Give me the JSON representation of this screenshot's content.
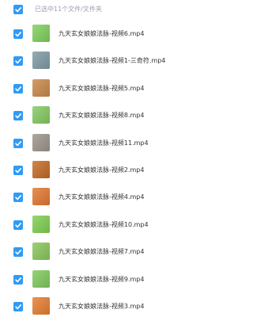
{
  "header": {
    "selection_text": "已选中11个文件/文件夹"
  },
  "files": [
    {
      "name": "九天玄女娘娘法脉-视频6.mp4",
      "thumb_color": "#7fcf5a"
    },
    {
      "name": "九天玄女娘娘法脉-视频1-三奇符.mp4",
      "thumb_color": "#7f9aa5"
    },
    {
      "name": "九天玄女娘娘法脉-视频5.mp4",
      "thumb_color": "#c8884a"
    },
    {
      "name": "九天玄女娘娘法脉-视频8.mp4",
      "thumb_color": "#84c95f"
    },
    {
      "name": "九天玄女娘娘法脉-视频11.mp4",
      "thumb_color": "#9c948a"
    },
    {
      "name": "九天玄女娘娘法脉-视频2.mp4",
      "thumb_color": "#c46a24"
    },
    {
      "name": "九天玄女娘娘法脉-视频4.mp4",
      "thumb_color": "#e2772f"
    },
    {
      "name": "九天玄女娘娘法脉-视频10.mp4",
      "thumb_color": "#7fcf4f"
    },
    {
      "name": "九天玄女娘娘法脉-视频7.mp4",
      "thumb_color": "#88c65b"
    },
    {
      "name": "九天玄女娘娘法脉-视频9.mp4",
      "thumb_color": "#7fc95d"
    },
    {
      "name": "九天玄女娘娘法脉-视频3.mp4",
      "thumb_color": "#e57d2f"
    }
  ],
  "colors": {
    "checkbox_fill": "#2f9bf6",
    "header_text": "#9aa2ad",
    "filename_text": "#333333"
  }
}
